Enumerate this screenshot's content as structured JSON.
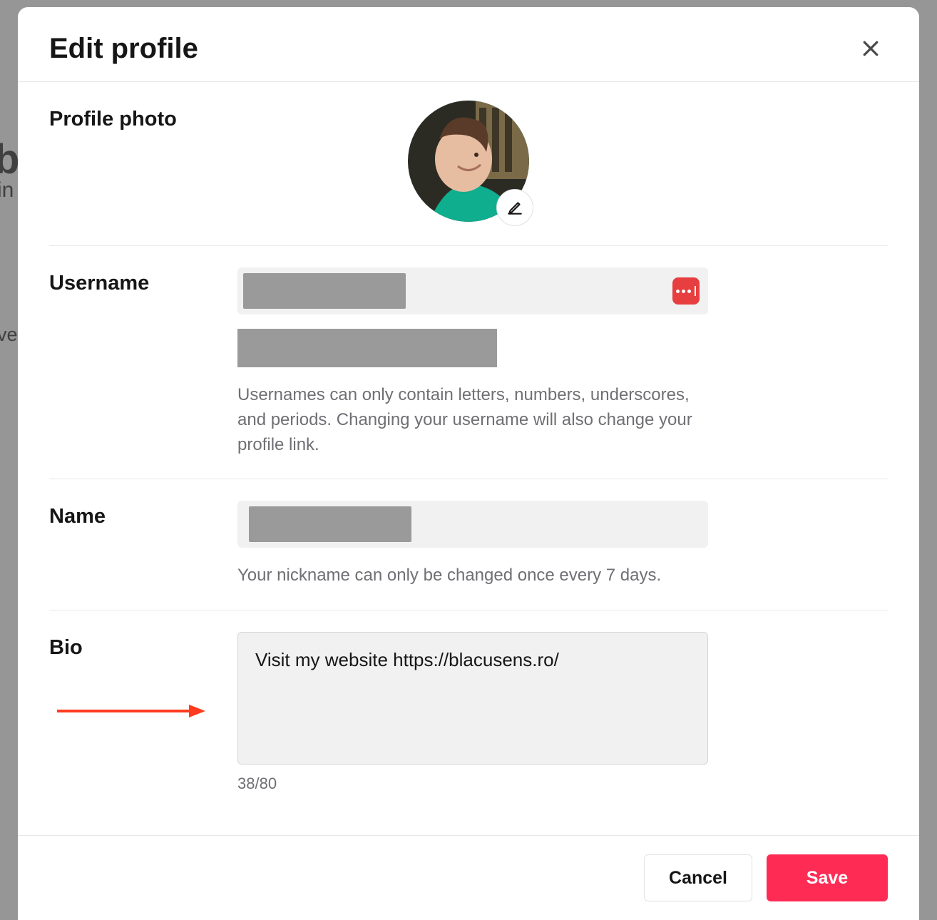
{
  "modal": {
    "title": "Edit profile",
    "footer": {
      "cancel": "Cancel",
      "save": "Save"
    }
  },
  "photo": {
    "label": "Profile photo"
  },
  "username": {
    "label": "Username",
    "hint": "Usernames can only contain letters, numbers, underscores, and periods. Changing your username will also change your profile link."
  },
  "name": {
    "label": "Name",
    "hint": "Your nickname can only be changed once every 7 days."
  },
  "bio": {
    "label": "Bio",
    "value": "Visit my website https://blacusens.ro/",
    "counter": "38/80"
  }
}
